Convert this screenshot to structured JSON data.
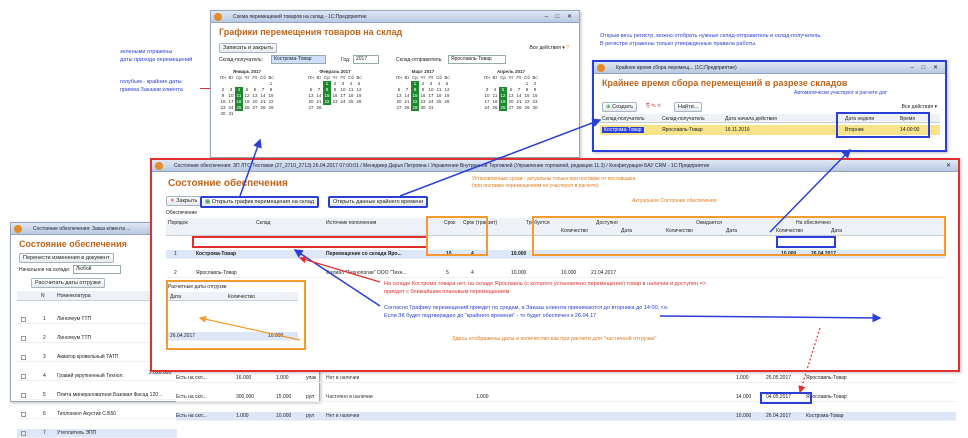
{
  "notes": {
    "green_legend": [
      "зелеными отражены",
      "даты прихода перемещений"
    ],
    "blue_legend": [
      "голубым - крайние даты",
      "приема Заказов клиента"
    ],
    "right_top": [
      "Открыв весь регистр, можно отобрать нужные склад-отправитель и склад-получатель.",
      "В регистре отражены только утвержденные правила работы."
    ],
    "auto_note": "Автоматически участвуют в расчете дат",
    "orange_top": [
      "Установленные сроки - актуальны только при поставке от поставщика",
      "(при поставке перемещением не участвуют в расчете)"
    ],
    "actual_state": "Актуальное Состояние обеспечения",
    "red_note": [
      "На складе Кострома товара нет, на складе Ярославль (с которого установлено перемещение) товар в наличии и доступен =>",
      "приедет с ближайшим плановым перемещением"
    ],
    "blue_note": [
      "Согласно Графику перемещений приедет по средам, а Заказы клиента принимаются до вторника до 14:00, т.е.",
      "Если ЗК будет подтвержден до \"крайнего времени\" - то будет обеспечен к 26.04.17"
    ],
    "orange_bottom": "Здесь отображены даты и количество как при расчете для \"частичной отгрузки\""
  },
  "schedule_window": {
    "title": "Схема перемещений товаров на склад - 1С:Предприятие",
    "heading": "Графики перемещения товаров на склад",
    "save_close": "Записать и закрыть",
    "all_actions": "Все действия",
    "receiver_label": "Склад-получатель:",
    "receiver_value": "Кострома-Товар",
    "year_label": "Год:",
    "year_value": "2017",
    "sender_label": "Склад-отправитель:",
    "sender_value": "Ярославль-Товар",
    "weekdays": [
      "Пн",
      "Вт",
      "Ср",
      "Чт",
      "Пт",
      "Сб",
      "Вс"
    ],
    "months": [
      {
        "name": "Январь 2017",
        "days": [
          "",
          "",
          "",
          "",
          "",
          "",
          "1",
          "2",
          "3",
          "4",
          "5",
          "6",
          "7",
          "8",
          "9",
          "10",
          "11",
          "12",
          "13",
          "14",
          "15",
          "16",
          "17",
          "18",
          "19",
          "20",
          "21",
          "22",
          "23",
          "24",
          "25",
          "26",
          "27",
          "28",
          "29",
          "30",
          "31"
        ],
        "green": [
          "4",
          "11",
          "18",
          "25"
        ]
      },
      {
        "name": "Февраль 2017",
        "days": [
          "",
          "",
          "1",
          "2",
          "3",
          "4",
          "5",
          "6",
          "7",
          "8",
          "9",
          "10",
          "11",
          "12",
          "13",
          "14",
          "15",
          "16",
          "17",
          "18",
          "19",
          "20",
          "21",
          "22",
          "23",
          "24",
          "25",
          "26",
          "27",
          "28"
        ],
        "green": [
          "1",
          "8",
          "15",
          "22"
        ]
      },
      {
        "name": "Март 2017",
        "days": [
          "",
          "",
          "1",
          "2",
          "3",
          "4",
          "5",
          "6",
          "7",
          "8",
          "9",
          "10",
          "11",
          "12",
          "13",
          "14",
          "15",
          "16",
          "17",
          "18",
          "19",
          "20",
          "21",
          "22",
          "23",
          "24",
          "25",
          "26",
          "27",
          "28",
          "29",
          "30",
          "31"
        ],
        "green": [
          "1",
          "8",
          "15",
          "22",
          "29"
        ]
      },
      {
        "name": "Апрель 2017",
        "days": [
          "",
          "",
          "",
          "",
          "",
          "1",
          "2",
          "3",
          "4",
          "5",
          "6",
          "7",
          "8",
          "9",
          "10",
          "11",
          "12",
          "13",
          "14",
          "15",
          "16",
          "17",
          "18",
          "19",
          "20",
          "21",
          "22",
          "23",
          "24",
          "25",
          "26",
          "27",
          "28",
          "29",
          "30"
        ],
        "green": [
          "5",
          "12",
          "19",
          "26"
        ]
      }
    ]
  },
  "deadline_window": {
    "title": "Крайнее время сбора перемещ... (1С:Предприятие)",
    "heading": "Крайнее время сбора перемещений в разрезе складов",
    "create": "Создать",
    "find": "Найти...",
    "all_actions": "Все действия",
    "columns": [
      "Склад-получатель",
      "Склад-получатель",
      "Дата начала действия",
      "Дата недели",
      "Время"
    ],
    "row": [
      "Кострома-Товар",
      "Ярославль-Товар",
      "16.11.2016",
      "Вторник",
      "14:00:00"
    ]
  },
  "supply_window": {
    "title": "Состояние обеспечения: ЗП ЛТС Тестовая (27_2710_2713) 26.04.2017 07:00:01 / Менеджер Дарья Петровна / Управление Внутренней Торговлей (Управление торговлей, редакция 11.3) / Конфигурация БАУ CRM - 1С:Предприятие",
    "heading": "Состояние обеспечения",
    "close": "Закрыть",
    "open_schedule": "Открыть график перемещения на склад",
    "open_deadline": "Открыть данные крайнего времени",
    "section": "Обеспечение",
    "columns": [
      "Порядок",
      "Склад",
      "Источник пополнения",
      "Срок",
      "Срок (транзит)",
      "Требуется",
      "Доступно",
      "Ожидается",
      "На обеспечено"
    ],
    "subcolumns": [
      "Количество",
      "Дата",
      "Количество",
      "Дата",
      "Количество",
      "Дата"
    ],
    "rows": [
      {
        "n": "1",
        "warehouse": "Кострома-Товар",
        "source": "Перемещение со склада Яро...",
        "term": "10",
        "transit": "4",
        "need": "10.000",
        "avail_qty": "",
        "avail_date": "",
        "ship_qty": "10.000",
        "ship_date": "26.04.2017"
      },
      {
        "n": "2",
        "warehouse": "Ярославль-Товар",
        "source": "Филиал \"Технологии\" ООО \"Техн...",
        "term": "5",
        "transit": "4",
        "need": "10.000",
        "avail_qty": "10.000",
        "avail_date": "21.04.2017",
        "ship_qty": "",
        "ship_date": ""
      }
    ],
    "calc_title": "Расчетные даты отгрузки",
    "calc_cols": [
      "Дата",
      "Количество"
    ],
    "calc_row": [
      "26.04.2017",
      "10.000"
    ]
  },
  "order_window": {
    "title": "Состояние обеспечения: Заказ клиента ...",
    "heading": "Состояние обеспечения",
    "btn": "Перенести изменения в документ",
    "warehouse_label": "Начальное на складе:",
    "warehouse_value": "Любой",
    "calc_btn": "Рассчитать даты отгрузки",
    "columns": [
      "N",
      "Номенклатура"
    ],
    "rows": [
      {
        "n": "1",
        "name": "Линолеум ТТП"
      },
      {
        "n": "2",
        "name": "Линолеум ТТП"
      },
      {
        "n": "3",
        "name": "Акватор кровельный ТАТП"
      },
      {
        "n": "4",
        "name": "Гравий укрупненный Технол."
      },
      {
        "n": "5",
        "name": "Плита минераловатная Базовая Фасад 120..."
      },
      {
        "n": "6",
        "name": "Теплоизол Акустик С.Б50"
      },
      {
        "n": "7",
        "name": "Утеплитель ЭПП"
      }
    ],
    "mid_value": "2.026.000",
    "bottom_rows": [
      {
        "type": "Есть на скл...",
        "qty": "16.000",
        "q2": "1.000",
        "unit": "упак",
        "status": "Нет в наличии",
        "avail": "1.000",
        "date": "26.05.2017",
        "wh": "Ярославль-Товар"
      },
      {
        "type": "Есть на скл...",
        "qty": "300.000",
        "q2": "15.000",
        "unit": "рул",
        "status": "Частично в наличии",
        "extra": "1.000",
        "avail": "14.000",
        "date": "04.05.2017",
        "wh": "Ярославль-Товар"
      },
      {
        "type": "Есть на скл...",
        "qty": "1.000",
        "q2": "10.000",
        "unit": "рул",
        "status": "Нет в наличии",
        "avail": "10.000",
        "date": "26.04.2017",
        "wh": "Кострома-Товар"
      }
    ]
  }
}
